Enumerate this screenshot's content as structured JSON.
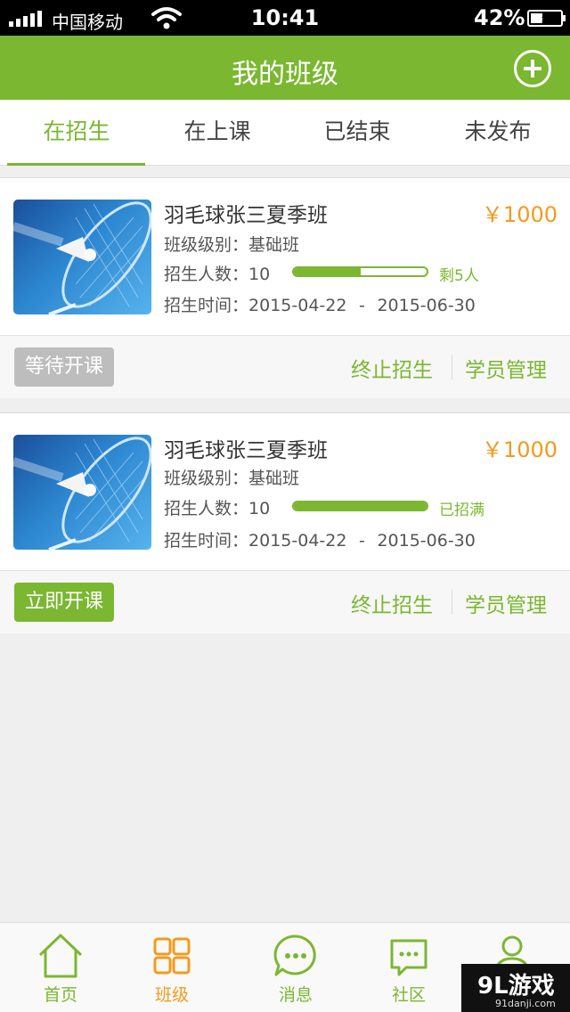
{
  "status_bar": {
    "carrier": "中国移动",
    "time": "10:41",
    "battery": "42%",
    "battery_level": 0.42
  },
  "nav": {
    "title": "我的班级",
    "add_icon": "plus-circle-icon"
  },
  "tabs": [
    {
      "label": "在招生",
      "active": true
    },
    {
      "label": "在上课",
      "active": false
    },
    {
      "label": "已结束",
      "active": false
    },
    {
      "label": "未发布",
      "active": false
    }
  ],
  "labels": {
    "level": "班级级别：",
    "enroll": "招生人数：",
    "time": "招生时间：",
    "date_sep": "-"
  },
  "classes": [
    {
      "title": "羽毛球张三夏季班",
      "price": "￥1000",
      "level": "基础班",
      "enroll_count": "10",
      "progress": 0.5,
      "progress_text": "剩5人",
      "start_date": "2015-04-22",
      "end_date": "2015-06-30",
      "status_button": "等待开课",
      "action_stop": "终止招生",
      "action_manage": "学员管理"
    },
    {
      "title": "羽毛球张三夏季班",
      "price": "￥1000",
      "level": "基础班",
      "enroll_count": "10",
      "progress": 1.0,
      "progress_text": "已招满",
      "start_date": "2015-04-22",
      "end_date": "2015-06-30",
      "status_button": "立即开课",
      "action_stop": "终止招生",
      "action_manage": "学员管理"
    }
  ],
  "tabbar": [
    {
      "label": "首页",
      "icon": "home-icon",
      "active": false
    },
    {
      "label": "班级",
      "icon": "grid-icon",
      "active": true
    },
    {
      "label": "消息",
      "icon": "message-icon",
      "active": false
    },
    {
      "label": "社区",
      "icon": "community-icon",
      "active": false
    },
    {
      "label": "",
      "icon": "user-icon",
      "active": false
    }
  ],
  "watermark": {
    "logo": "9L游戏",
    "url": "91danji.com"
  },
  "colors": {
    "brand_green": "#7bb731",
    "price_orange": "#f39a1e",
    "waiting_gray": "#bdbdbd"
  }
}
